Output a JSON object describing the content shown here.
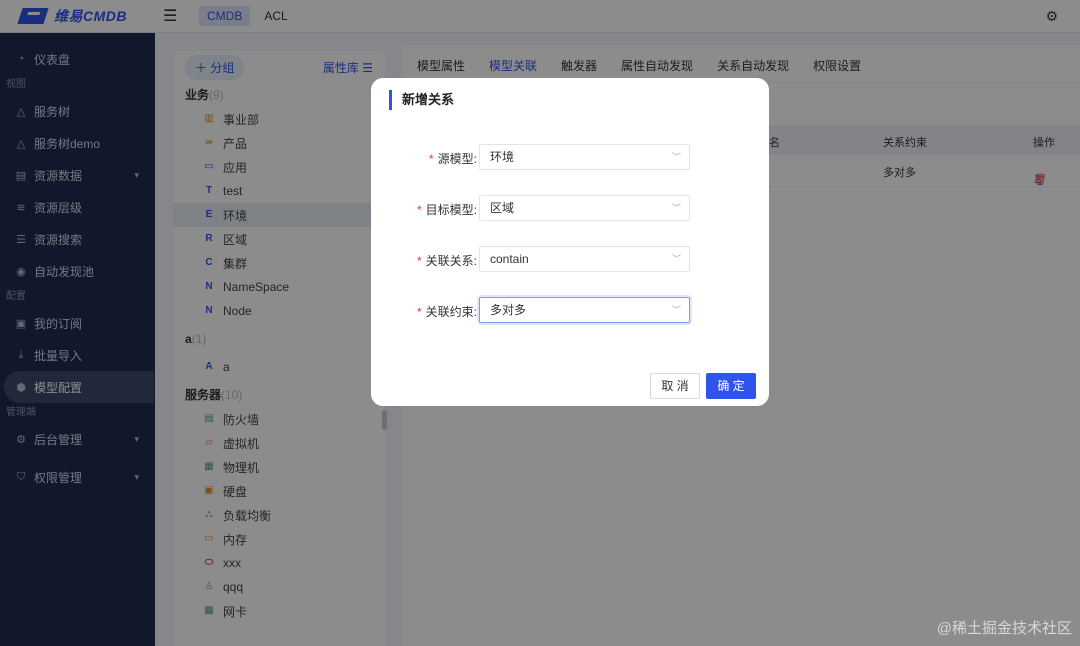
{
  "topbar": {
    "logo_text": "维易CMDB",
    "tabs": [
      {
        "label": "CMDB"
      },
      {
        "label": "ACL"
      }
    ]
  },
  "sidebar": {
    "item_dashboard": "仪表盘",
    "group_view": "视图",
    "item_service_tree": "服务树",
    "item_service_tree_demo": "服务树demo",
    "item_resource_data": "资源数据",
    "item_resource_level": "资源层级",
    "item_resource_search": "资源搜索",
    "item_auto_discovery": "自动发现池",
    "group_config": "配置",
    "item_my_subscription": "我的订阅",
    "item_batch_import": "批量导入",
    "item_model_config": "模型配置",
    "group_admin": "管理端",
    "item_backend_admin": "后台管理",
    "item_permission_admin": "权限管理"
  },
  "tree": {
    "add_group_label": "分组",
    "attr_lib_label": "属性库",
    "cat_business": "业务",
    "cat_business_count": "(9)",
    "business_nodes": [
      {
        "icon": "▥",
        "label": "事业部"
      },
      {
        "icon": "∞",
        "label": "产品"
      },
      {
        "icon": "▭",
        "label": "应用"
      },
      {
        "icon": "T",
        "label": "test"
      },
      {
        "icon": "E",
        "label": "环境"
      },
      {
        "icon": "R",
        "label": "区域"
      },
      {
        "icon": "C",
        "label": "集群"
      },
      {
        "icon": "N",
        "label": "NameSpace"
      },
      {
        "icon": "N",
        "label": "Node"
      }
    ],
    "cat_a": "a",
    "cat_a_count": "(1)",
    "a_nodes": [
      {
        "icon": "A",
        "label": "a"
      }
    ],
    "cat_server": "服务器",
    "cat_server_count": "(10)",
    "server_nodes": [
      {
        "icon": "▤",
        "label": "防火墙"
      },
      {
        "icon": "▱",
        "label": "虚拟机"
      },
      {
        "icon": "▦",
        "label": "物理机"
      },
      {
        "icon": "▣",
        "label": "硬盘"
      },
      {
        "icon": "⛬",
        "label": "负载均衡"
      },
      {
        "icon": "▭",
        "label": "内存"
      },
      {
        "icon": "⬭",
        "label": "xxx"
      },
      {
        "icon": "♙",
        "label": "qqq"
      },
      {
        "icon": "▩",
        "label": "网卡"
      }
    ]
  },
  "main": {
    "tabs": [
      {
        "label": "模型属性"
      },
      {
        "label": "模型关联"
      },
      {
        "label": "触发器"
      },
      {
        "label": "属性自动发现"
      },
      {
        "label": "关系自动发现"
      },
      {
        "label": "权限设置"
      }
    ],
    "col_name_partial": "名",
    "col_constraint": "关系约束",
    "col_action": "操作",
    "row_constraint": "多对多"
  },
  "modal": {
    "title": "新增关系",
    "fields": [
      {
        "label": "源模型:",
        "value": "环境"
      },
      {
        "label": "目标模型:",
        "value": "区域"
      },
      {
        "label": "关联关系:",
        "value": "contain"
      },
      {
        "label": "关联约束:",
        "value": "多对多"
      }
    ],
    "cancel_label": "取 消",
    "ok_label": "确 定"
  },
  "watermark": "@稀土掘金技术社区"
}
